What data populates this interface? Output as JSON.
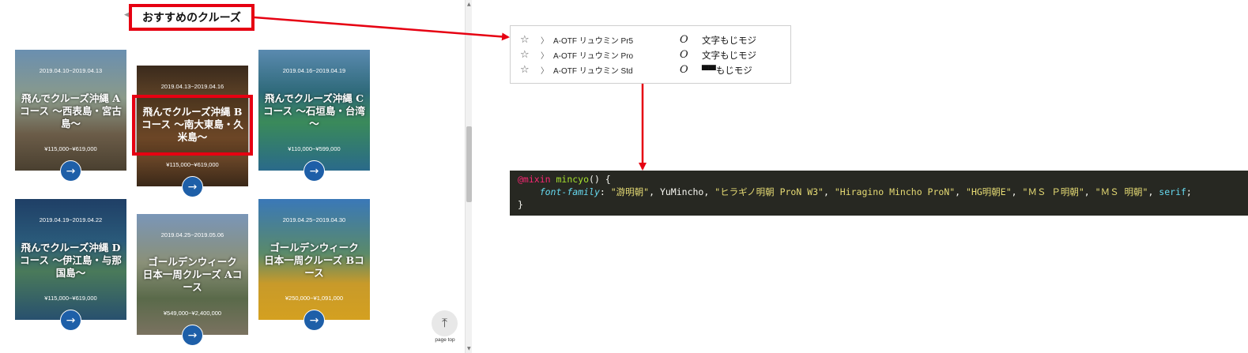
{
  "heading": "おすすめのクルーズ",
  "cards": [
    {
      "date": "2019.04.10~2019.04.13",
      "title": "飛んでクルーズ沖縄 Aコース ～西表島・宮古島～",
      "price": "¥115,000~¥619,000"
    },
    {
      "date": "2019.04.13~2019.04.16",
      "title": "飛んでクルーズ沖縄 Bコース ～南大東島・久米島～",
      "price": "¥115,000~¥619,000"
    },
    {
      "date": "2019.04.16~2019.04.19",
      "title": "飛んでクルーズ沖縄 Cコース ～石垣島・台湾～",
      "price": "¥110,000~¥599,000"
    },
    {
      "date": "2019.04.19~2019.04.22",
      "title": "飛んでクルーズ沖縄 Dコース ～伊江島・与那国島～",
      "price": "¥115,000~¥619,000"
    },
    {
      "date": "2019.04.25~2019.05.06",
      "title": "ゴールデンウィーク 日本一周クルーズ Aコース",
      "price": "¥549,000~¥2,400,000"
    },
    {
      "date": "2019.04.25~2019.04.30",
      "title": "ゴールデンウィーク 日本一周クルーズ Bコース",
      "price": "¥250,000~¥1,091,000"
    }
  ],
  "card_button_icon": "→",
  "pagetop": {
    "icon": "⤒",
    "label": "page top"
  },
  "font_panel": {
    "rows": [
      {
        "name": "A-OTF リュウミン Pr5",
        "type_glyph": "O",
        "sample": "文字もじモジ"
      },
      {
        "name": "A-OTF リュウミン Pro",
        "type_glyph": "O",
        "sample": "文字もじモジ"
      },
      {
        "name": "A-OTF リュウミン Std",
        "type_glyph": "O",
        "sample": "▀▀もじモジ"
      }
    ],
    "star_icon": "☆",
    "chevron_icon": "〉"
  },
  "code": {
    "line1_kw": "@mixin",
    "line1_fn": "mincyo",
    "line1_rest": "() {",
    "line2_prop": "font-family",
    "line2_colon": ": ",
    "s1": "\"游明朝\"",
    "s_sep1": ", ",
    "s2": "YuMincho",
    "s_sep2": ", ",
    "s3": "\"ヒラギノ明朝 ProN W3\"",
    "s_sep3": ", ",
    "s4": "\"Hiragino Mincho ProN\"",
    "s_sep4": ", ",
    "s5": "\"HG明朝E\"",
    "s_sep5": ", ",
    "s6": "\"ＭＳ Ｐ明朝\"",
    "s_sep6": ", ",
    "s7": "\"ＭＳ 明朝\"",
    "s_sep7": ", ",
    "s8": "serif",
    "s_end": ";",
    "line3": "}"
  },
  "colors": {
    "highlight": "#e60012",
    "button": "#1e5fa8",
    "code_bg": "#272822"
  }
}
